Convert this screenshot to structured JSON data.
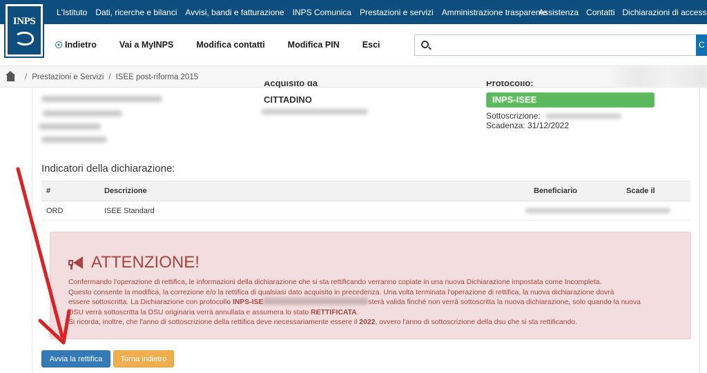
{
  "logo": {
    "text": "INPS"
  },
  "topnav": {
    "left": [
      "L'Istituto",
      "Dati, ricerche e bilanci",
      "Avvisi, bandi e fatturazione",
      "INPS Comunica",
      "Prestazioni e servizi",
      "Amministrazione trasparente"
    ],
    "right": [
      "Assistenza",
      "Contatti",
      "Dichiarazioni di accessibilità"
    ]
  },
  "subnav": {
    "back": "Indietro",
    "myinps": "Vai a MyINPS",
    "contacts": "Modifica contatti",
    "pin": "Modifica PIN",
    "exit": "Esci"
  },
  "search": {
    "placeholder": "",
    "button": "C"
  },
  "breadcrumb": {
    "items": [
      "Prestazioni e Servizi",
      "ISEE post-riforma 2015"
    ],
    "separator": "/"
  },
  "info": {
    "acquired_label": "Acquisito da",
    "acquired_value": "CITTADINO",
    "protocol_label": "Protocollo:",
    "protocol_value": "INPS-ISEE",
    "subscription_label": "Sottoscrizione:",
    "expiry": "Scadenza: 31/12/2022"
  },
  "indicators": {
    "title": "Indicatori della dichiarazione:",
    "columns": [
      "#",
      "Descrizione",
      "Beneficiario",
      "Scade il"
    ],
    "rows": [
      {
        "code": "ORD",
        "description": "ISEE Standard"
      }
    ]
  },
  "alert": {
    "title": "ATTENZIONE!",
    "line1": "Confermando l'operazione di rettifica, le informazioni della dichiarazione che si sta rettificando verranno copiate in una nuova Dichiarazione impostata come Incompleta.",
    "line2": "Questo consente la modifica, la correzione e/o la rettifica di qualsiasi dato acquisito in precedenza. Una volta terminata l'operazione di rettifica, la nuova dichiarazione dovrà",
    "line3a": "essere sottoscritta. La Dichiarazione con protocollo ",
    "line3_proto": "INPS-ISE",
    "line3b": "sterà valida finché non verrà sottoscritta la nuova dichiarazione, solo quando la nuova",
    "line4a": "DSU verrà sottoscritta la DSU originaria verrà annullata e assumera lo stato ",
    "line4_status": "RETTIFICATA",
    "line4b": ".",
    "line5a": "Si ricorda, inoltre, che l'anno di sottoscrizione della rettifica deve necessariamente essere il ",
    "line5_year": "2022",
    "line5b": ", ovvero l'anno di sottoscrizione della dsu che si sta rettificando."
  },
  "buttons": {
    "start": "Avvia la rettifica",
    "back": "Torna indietro"
  },
  "colors": {
    "brand": "#0e4e7e",
    "alert_text": "#a94442",
    "alert_bg": "#f2dede",
    "primary": "#337ab7",
    "warning": "#f0ad4e",
    "success": "#5cb85c",
    "annotation_arrow": "#e02020"
  }
}
